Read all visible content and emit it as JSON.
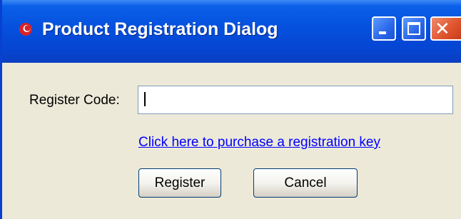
{
  "window": {
    "title": "Product Registration Dialog",
    "app_icon": "app-logo-icon",
    "controls": {
      "minimize_icon": "minimize-icon",
      "maximize_icon": "maximize-icon",
      "close_icon": "close-icon",
      "close_glyph": "✕"
    }
  },
  "form": {
    "code_label": "Register Code:",
    "code_value": "",
    "purchase_link": "Click here to purchase a registration key",
    "register_label": "Register",
    "cancel_label": "Cancel"
  },
  "colors": {
    "titlebar": "#0550dd",
    "window_bg": "#ece9d8",
    "link": "#0000ff",
    "close_button": "#e0552f"
  }
}
